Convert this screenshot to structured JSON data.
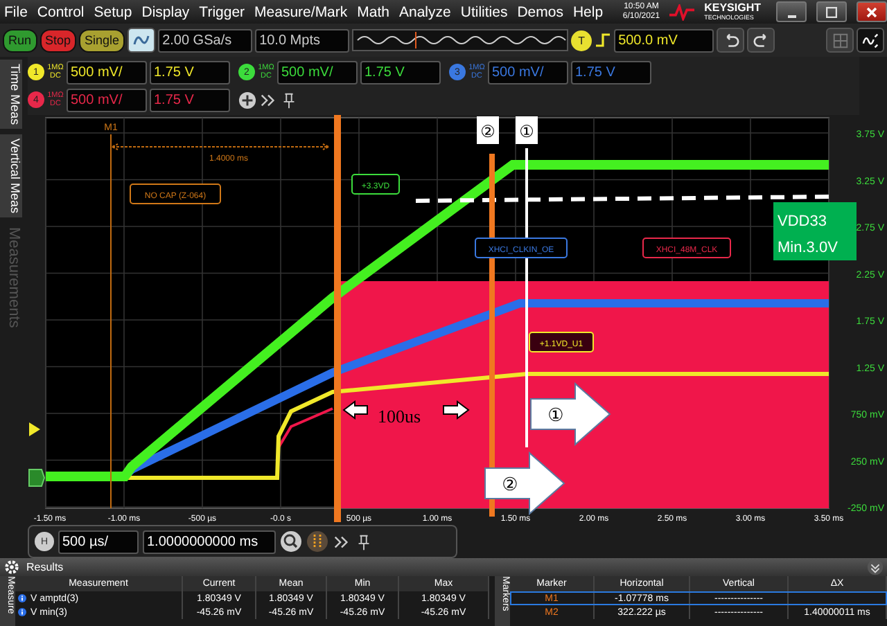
{
  "menu": [
    "File",
    "Control",
    "Setup",
    "Display",
    "Trigger",
    "Measure/Mark",
    "Math",
    "Analyze",
    "Utilities",
    "Demos",
    "Help"
  ],
  "clock": {
    "time": "10:50 AM",
    "date": "6/10/2021"
  },
  "brand": {
    "name": "KEYSIGHT",
    "sub": "TECHNOLOGIES"
  },
  "run_controls": [
    {
      "label": "Run",
      "kind": "run"
    },
    {
      "label": "Stop",
      "kind": "stop"
    },
    {
      "label": "Single",
      "kind": "single"
    }
  ],
  "sample_rate": "2.00 GSa/s",
  "memory_depth": "10.0 Mpts",
  "trigger": {
    "badge": "T",
    "level": "500.0 mV"
  },
  "channels": [
    {
      "number": "1",
      "coupling_top": "1MΩ",
      "coupling_bottom": "DC",
      "scale": "500 mV/",
      "offset": "1.75 V",
      "color": "#f0e82a"
    },
    {
      "number": "2",
      "coupling_top": "1MΩ",
      "coupling_bottom": "DC",
      "scale": "500 mV/",
      "offset": "1.75 V",
      "color": "#3cdc3c"
    },
    {
      "number": "3",
      "coupling_top": "1MΩ",
      "coupling_bottom": "DC",
      "scale": "500 mV/",
      "offset": "1.75 V",
      "color": "#3a78e0"
    },
    {
      "number": "4",
      "coupling_top": "1MΩ",
      "coupling_bottom": "DC",
      "scale": "500 mV/",
      "offset": "1.75 V",
      "color": "#e8284a"
    }
  ],
  "side_tabs": [
    {
      "label": "Time Meas",
      "disabled": false
    },
    {
      "label": "Vertical Meas",
      "disabled": false
    },
    {
      "label": "Measurements",
      "disabled": true
    }
  ],
  "plot": {
    "x_labels": [
      "-1.50 ms",
      "-1.00 ms",
      "-500 µs",
      "-0.0 s",
      "500 µs",
      "1.00 ms",
      "1.50 ms",
      "2.00 ms",
      "2.50 ms",
      "3.00 ms",
      "3.50 ms"
    ],
    "y_labels": [
      "3.75 V",
      "3.25 V",
      "2.75 V",
      "2.25 V",
      "1.75 V",
      "1.25 V",
      "750 mV",
      "250 mV",
      "-250 mV"
    ],
    "marker": "M1",
    "delta": "1.4000 ms",
    "labels": [
      {
        "text": "NO CAP (Z-064)",
        "color": "#d07818"
      },
      {
        "text": "+3.3VD",
        "color": "#3cdc3c"
      },
      {
        "text": "XHCI_CLKIN_OE",
        "color": "#3a78e0"
      },
      {
        "text": "XHCI_48M_CLK",
        "color": "#e8284a"
      },
      {
        "text": "+1.1VD_U1",
        "color": "#f0e82a"
      }
    ],
    "callout": {
      "title": "VDD33",
      "text": "Min.3.0V"
    },
    "cursor_labels": [
      "②",
      "①"
    ],
    "span_text": "100us",
    "arrows": [
      "①",
      "②"
    ]
  },
  "horizontal": {
    "badge": "H",
    "scale": "500 µs/",
    "position": "1.0000000000 ms"
  },
  "results": {
    "title": "Results",
    "tab": "Measure",
    "columns": [
      "Measurement",
      "Current",
      "Mean",
      "Min",
      "Max"
    ],
    "rows": [
      {
        "name": "V amptd(3)",
        "values": [
          "1.80349 V",
          "1.80349 V",
          "1.80349 V",
          "1.80349 V"
        ]
      },
      {
        "name": "V min(3)",
        "values": [
          "-45.26 mV",
          "-45.26 mV",
          "-45.26 mV",
          "-45.26 mV"
        ]
      }
    ]
  },
  "markers_panel": {
    "tab": "Markers",
    "columns": [
      "Marker",
      "Horizontal",
      "Vertical",
      "ΔX"
    ],
    "rows": [
      {
        "name": "M1",
        "horizontal": "-1.07778 ms",
        "vertical": "---------------",
        "dx": "",
        "selected": true
      },
      {
        "name": "M2",
        "horizontal": "322.222 µs",
        "vertical": "---------------",
        "dx": "1.40000011 ms",
        "selected": false
      }
    ]
  }
}
